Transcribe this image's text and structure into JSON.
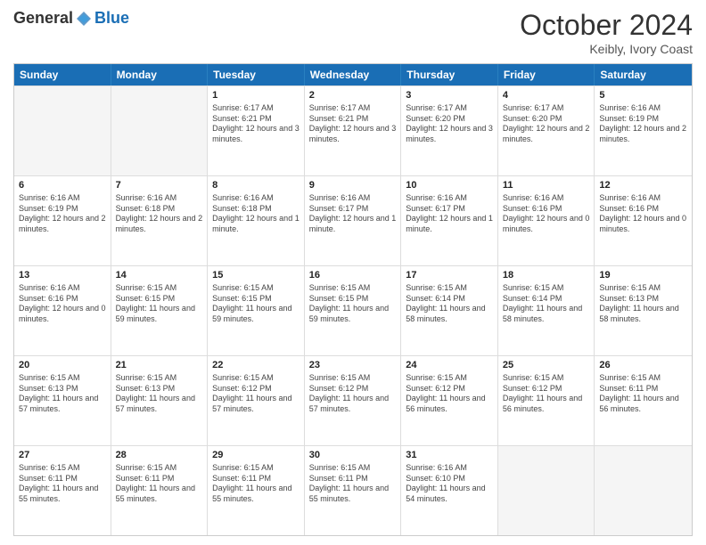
{
  "header": {
    "logo": {
      "general": "General",
      "blue": "Blue"
    },
    "title": "October 2024",
    "location": "Keibly, Ivory Coast"
  },
  "weekdays": [
    "Sunday",
    "Monday",
    "Tuesday",
    "Wednesday",
    "Thursday",
    "Friday",
    "Saturday"
  ],
  "weeks": [
    [
      {
        "day": "",
        "sunrise": "",
        "sunset": "",
        "daylight": "",
        "empty": true
      },
      {
        "day": "",
        "sunrise": "",
        "sunset": "",
        "daylight": "",
        "empty": true
      },
      {
        "day": "1",
        "sunrise": "Sunrise: 6:17 AM",
        "sunset": "Sunset: 6:21 PM",
        "daylight": "Daylight: 12 hours and 3 minutes.",
        "empty": false
      },
      {
        "day": "2",
        "sunrise": "Sunrise: 6:17 AM",
        "sunset": "Sunset: 6:21 PM",
        "daylight": "Daylight: 12 hours and 3 minutes.",
        "empty": false
      },
      {
        "day": "3",
        "sunrise": "Sunrise: 6:17 AM",
        "sunset": "Sunset: 6:20 PM",
        "daylight": "Daylight: 12 hours and 3 minutes.",
        "empty": false
      },
      {
        "day": "4",
        "sunrise": "Sunrise: 6:17 AM",
        "sunset": "Sunset: 6:20 PM",
        "daylight": "Daylight: 12 hours and 2 minutes.",
        "empty": false
      },
      {
        "day": "5",
        "sunrise": "Sunrise: 6:16 AM",
        "sunset": "Sunset: 6:19 PM",
        "daylight": "Daylight: 12 hours and 2 minutes.",
        "empty": false
      }
    ],
    [
      {
        "day": "6",
        "sunrise": "Sunrise: 6:16 AM",
        "sunset": "Sunset: 6:19 PM",
        "daylight": "Daylight: 12 hours and 2 minutes.",
        "empty": false
      },
      {
        "day": "7",
        "sunrise": "Sunrise: 6:16 AM",
        "sunset": "Sunset: 6:18 PM",
        "daylight": "Daylight: 12 hours and 2 minutes.",
        "empty": false
      },
      {
        "day": "8",
        "sunrise": "Sunrise: 6:16 AM",
        "sunset": "Sunset: 6:18 PM",
        "daylight": "Daylight: 12 hours and 1 minute.",
        "empty": false
      },
      {
        "day": "9",
        "sunrise": "Sunrise: 6:16 AM",
        "sunset": "Sunset: 6:17 PM",
        "daylight": "Daylight: 12 hours and 1 minute.",
        "empty": false
      },
      {
        "day": "10",
        "sunrise": "Sunrise: 6:16 AM",
        "sunset": "Sunset: 6:17 PM",
        "daylight": "Daylight: 12 hours and 1 minute.",
        "empty": false
      },
      {
        "day": "11",
        "sunrise": "Sunrise: 6:16 AM",
        "sunset": "Sunset: 6:16 PM",
        "daylight": "Daylight: 12 hours and 0 minutes.",
        "empty": false
      },
      {
        "day": "12",
        "sunrise": "Sunrise: 6:16 AM",
        "sunset": "Sunset: 6:16 PM",
        "daylight": "Daylight: 12 hours and 0 minutes.",
        "empty": false
      }
    ],
    [
      {
        "day": "13",
        "sunrise": "Sunrise: 6:16 AM",
        "sunset": "Sunset: 6:16 PM",
        "daylight": "Daylight: 12 hours and 0 minutes.",
        "empty": false
      },
      {
        "day": "14",
        "sunrise": "Sunrise: 6:15 AM",
        "sunset": "Sunset: 6:15 PM",
        "daylight": "Daylight: 11 hours and 59 minutes.",
        "empty": false
      },
      {
        "day": "15",
        "sunrise": "Sunrise: 6:15 AM",
        "sunset": "Sunset: 6:15 PM",
        "daylight": "Daylight: 11 hours and 59 minutes.",
        "empty": false
      },
      {
        "day": "16",
        "sunrise": "Sunrise: 6:15 AM",
        "sunset": "Sunset: 6:15 PM",
        "daylight": "Daylight: 11 hours and 59 minutes.",
        "empty": false
      },
      {
        "day": "17",
        "sunrise": "Sunrise: 6:15 AM",
        "sunset": "Sunset: 6:14 PM",
        "daylight": "Daylight: 11 hours and 58 minutes.",
        "empty": false
      },
      {
        "day": "18",
        "sunrise": "Sunrise: 6:15 AM",
        "sunset": "Sunset: 6:14 PM",
        "daylight": "Daylight: 11 hours and 58 minutes.",
        "empty": false
      },
      {
        "day": "19",
        "sunrise": "Sunrise: 6:15 AM",
        "sunset": "Sunset: 6:13 PM",
        "daylight": "Daylight: 11 hours and 58 minutes.",
        "empty": false
      }
    ],
    [
      {
        "day": "20",
        "sunrise": "Sunrise: 6:15 AM",
        "sunset": "Sunset: 6:13 PM",
        "daylight": "Daylight: 11 hours and 57 minutes.",
        "empty": false
      },
      {
        "day": "21",
        "sunrise": "Sunrise: 6:15 AM",
        "sunset": "Sunset: 6:13 PM",
        "daylight": "Daylight: 11 hours and 57 minutes.",
        "empty": false
      },
      {
        "day": "22",
        "sunrise": "Sunrise: 6:15 AM",
        "sunset": "Sunset: 6:12 PM",
        "daylight": "Daylight: 11 hours and 57 minutes.",
        "empty": false
      },
      {
        "day": "23",
        "sunrise": "Sunrise: 6:15 AM",
        "sunset": "Sunset: 6:12 PM",
        "daylight": "Daylight: 11 hours and 57 minutes.",
        "empty": false
      },
      {
        "day": "24",
        "sunrise": "Sunrise: 6:15 AM",
        "sunset": "Sunset: 6:12 PM",
        "daylight": "Daylight: 11 hours and 56 minutes.",
        "empty": false
      },
      {
        "day": "25",
        "sunrise": "Sunrise: 6:15 AM",
        "sunset": "Sunset: 6:12 PM",
        "daylight": "Daylight: 11 hours and 56 minutes.",
        "empty": false
      },
      {
        "day": "26",
        "sunrise": "Sunrise: 6:15 AM",
        "sunset": "Sunset: 6:11 PM",
        "daylight": "Daylight: 11 hours and 56 minutes.",
        "empty": false
      }
    ],
    [
      {
        "day": "27",
        "sunrise": "Sunrise: 6:15 AM",
        "sunset": "Sunset: 6:11 PM",
        "daylight": "Daylight: 11 hours and 55 minutes.",
        "empty": false
      },
      {
        "day": "28",
        "sunrise": "Sunrise: 6:15 AM",
        "sunset": "Sunset: 6:11 PM",
        "daylight": "Daylight: 11 hours and 55 minutes.",
        "empty": false
      },
      {
        "day": "29",
        "sunrise": "Sunrise: 6:15 AM",
        "sunset": "Sunset: 6:11 PM",
        "daylight": "Daylight: 11 hours and 55 minutes.",
        "empty": false
      },
      {
        "day": "30",
        "sunrise": "Sunrise: 6:15 AM",
        "sunset": "Sunset: 6:11 PM",
        "daylight": "Daylight: 11 hours and 55 minutes.",
        "empty": false
      },
      {
        "day": "31",
        "sunrise": "Sunrise: 6:16 AM",
        "sunset": "Sunset: 6:10 PM",
        "daylight": "Daylight: 11 hours and 54 minutes.",
        "empty": false
      },
      {
        "day": "",
        "sunrise": "",
        "sunset": "",
        "daylight": "",
        "empty": true
      },
      {
        "day": "",
        "sunrise": "",
        "sunset": "",
        "daylight": "",
        "empty": true
      }
    ]
  ]
}
